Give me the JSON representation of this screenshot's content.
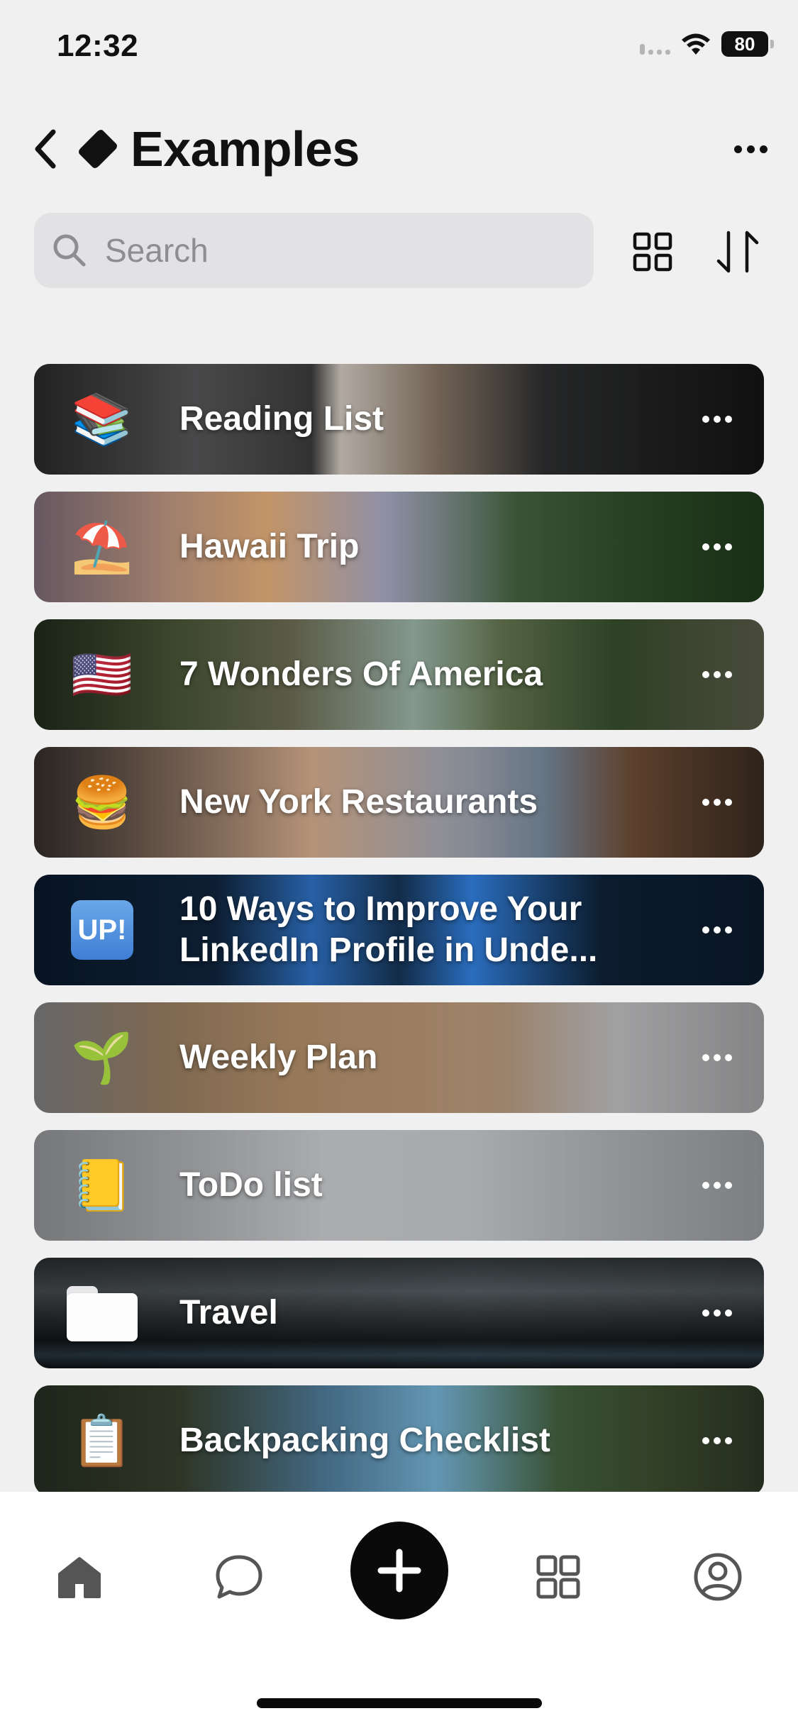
{
  "status_bar": {
    "time": "12:32",
    "battery": "80"
  },
  "header": {
    "title": "Examples",
    "back_icon": "chevron-left-icon",
    "title_icon": "diamond-icon",
    "more_icon": "ellipsis-icon"
  },
  "search": {
    "placeholder": "Search"
  },
  "lists": [
    {
      "title": "Reading List",
      "emoji": "📚",
      "bg": "linear-gradient(90deg,#2f2f30 0%,#5a5a5c 22%,#3a3a3b 38%,#c9c1b8 42%,#7a6a5c 55%,#2a2b2c 70%,#141414 100%)"
    },
    {
      "title": "Hawaii Trip",
      "emoji": "⛱️",
      "bg": "linear-gradient(90deg,#8e7a86 0%,#c9a08a 18%,#e6b07c 32%,#9e9fb8 48%,#3f5a3a 66%,#2c4a26 82%,#1f3a1c 100%)"
    },
    {
      "title": "7 Wonders Of America",
      "emoji": "🇺🇸",
      "bg": "linear-gradient(90deg,#24301f 0%,#4d5a3a 20%,#6a6a52 35%,#8fa59a 52%,#5a6a48 64%,#344a2a 80%,#5b5c4a 100%)"
    },
    {
      "title": "New York Restaurants",
      "emoji": "🍔",
      "bg": "linear-gradient(90deg,#3a3430 0%,#8a7262 20%,#d0a98a 38%,#9b9aa1 55%,#6f7f90 70%,#6b4a33 82%,#3a2c22 100%)"
    },
    {
      "title": "10 Ways to Improve Your LinkedIn Profile in Unde...",
      "emoji": "UP!",
      "bg": "linear-gradient(90deg,#0b1b2f 0%,#10263f 25%,#2d6fbf 38%,#14304f 50%,#2c73c8 60%,#0d2034 78%,#0b1a2c 100%)"
    },
    {
      "title": "Weekly Plan",
      "emoji": "🌱",
      "bg": "linear-gradient(90deg,#8e8e90 0%,#a08466 18%,#b08d68 35%,#a9896a 52%,#a58a70 64%,#b7b7b9 80%,#a6a6a8 100%)"
    },
    {
      "title": "ToDo list",
      "emoji": "📒",
      "bg": "linear-gradient(90deg,#a4a6a9 0%,#c3c5c8 40%,#b0b3b6 60%,#9b9ea2 100%)"
    },
    {
      "title": "Travel",
      "emoji": "📁",
      "bg": "linear-gradient(180deg,#2b3033 0%,#4c5256 30%,#2b2f31 55%,#14181a 75%,#2a3a46 88%,#0f1214 100%)"
    },
    {
      "title": "Backpacking Checklist",
      "emoji": "📋",
      "bg": "linear-gradient(90deg,#2a3324 0%,#3a4330 20%,#4d7896 40%,#6aa1c0 55%,#3f5a3a 72%,#3a4a2e 86%,#2c3826 100%)"
    }
  ],
  "tabbar": {
    "home_icon": "home-icon",
    "chat_icon": "chat-bubble-icon",
    "add_icon": "plus-icon",
    "apps_icon": "grid-icon",
    "profile_icon": "profile-icon"
  }
}
